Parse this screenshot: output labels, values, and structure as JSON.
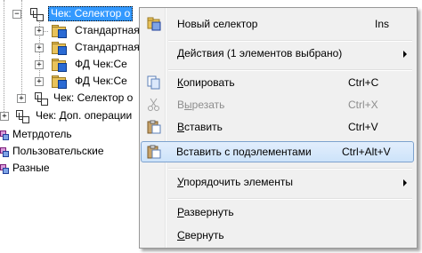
{
  "tree": {
    "rows": [
      {
        "label": "Чек: Селектор о",
        "selected": true
      },
      {
        "label": "Стандартная"
      },
      {
        "label": "Стандартная"
      },
      {
        "label": "ФД Чек:Се"
      },
      {
        "label": "ФД Чек:Се"
      },
      {
        "label": "Чек: Селектор о"
      },
      {
        "label": "Чек: Доп. операции"
      },
      {
        "label": "Метрдотель"
      },
      {
        "label": "Пользовательские"
      },
      {
        "label": "Разные"
      }
    ]
  },
  "menu": {
    "items": [
      {
        "id": "new",
        "label": "Новый селектор",
        "shortcut": "Ins",
        "icon": "new-selector-icon"
      },
      {
        "id": "actions",
        "label": "Действия (1 элементов выбрано)",
        "submenu": true
      },
      {
        "id": "copy",
        "label": "Копировать",
        "mnemonic": "К",
        "rest": "опировать",
        "shortcut": "Ctrl+C",
        "icon": "copy-icon"
      },
      {
        "id": "cut",
        "label": "Вырезать",
        "mnemonic": "ы",
        "pre": "В",
        "rest": "резать",
        "shortcut": "Ctrl+X",
        "disabled": true,
        "icon": "scissors-icon"
      },
      {
        "id": "paste",
        "label": "Вставить",
        "mnemonic": "В",
        "rest": "ставить",
        "shortcut": "Ctrl+V",
        "icon": "paste-icon"
      },
      {
        "id": "paste-sub",
        "label": "Вставить с подэлементами",
        "shortcut": "Ctrl+Alt+V",
        "highlighted": true,
        "icon": "paste-with-children-icon"
      },
      {
        "id": "sort",
        "label": "Упорядочить элементы",
        "mnemonic": "У",
        "rest": "порядочить элементы",
        "submenu": true
      },
      {
        "id": "expand",
        "label": "Развернуть",
        "mnemonic": "Р",
        "rest": "азвернуть"
      },
      {
        "id": "collapse",
        "label": "Свернуть",
        "mnemonic": "С",
        "rest": "вернуть"
      }
    ]
  }
}
